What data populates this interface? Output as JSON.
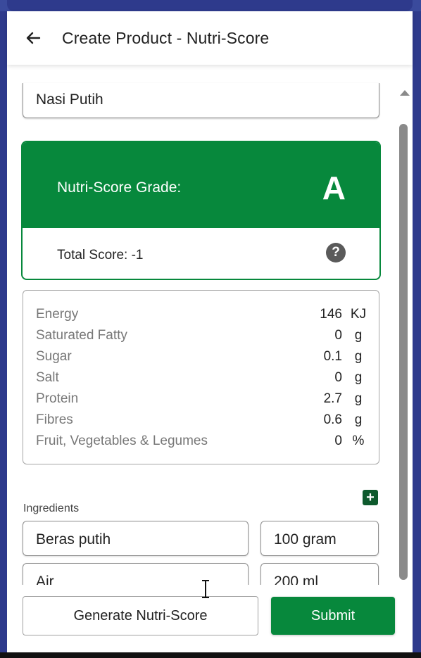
{
  "header": {
    "title": "Create Product - Nutri-Score",
    "back_icon": "arrow-left-icon"
  },
  "product": {
    "name_value": "Nasi Putih"
  },
  "grade": {
    "label": "Nutri-Score Grade:",
    "letter": "A",
    "total_score_label": "Total Score: -1",
    "help_icon": "help-circle-icon",
    "color": "#07883c"
  },
  "nutrients": [
    {
      "label": "Energy",
      "value": "146",
      "unit": "KJ"
    },
    {
      "label": "Saturated Fatty",
      "value": "0",
      "unit": "g"
    },
    {
      "label": "Sugar",
      "value": "0.1",
      "unit": "g"
    },
    {
      "label": "Salt",
      "value": "0",
      "unit": "g"
    },
    {
      "label": "Protein",
      "value": "2.7",
      "unit": "g"
    },
    {
      "label": "Fibres",
      "value": "0.6",
      "unit": "g"
    },
    {
      "label": "Fruit, Vegetables & Legumes",
      "value": "0",
      "unit": "%"
    }
  ],
  "ingredients": {
    "label": "Ingredients",
    "add_icon": "plus-icon",
    "items": [
      {
        "name": "Beras putih",
        "amount": "100 gram"
      },
      {
        "name": "Air",
        "amount": "200 ml"
      }
    ]
  },
  "footer": {
    "generate_label": "Generate Nutri-Score",
    "submit_label": "Submit"
  }
}
